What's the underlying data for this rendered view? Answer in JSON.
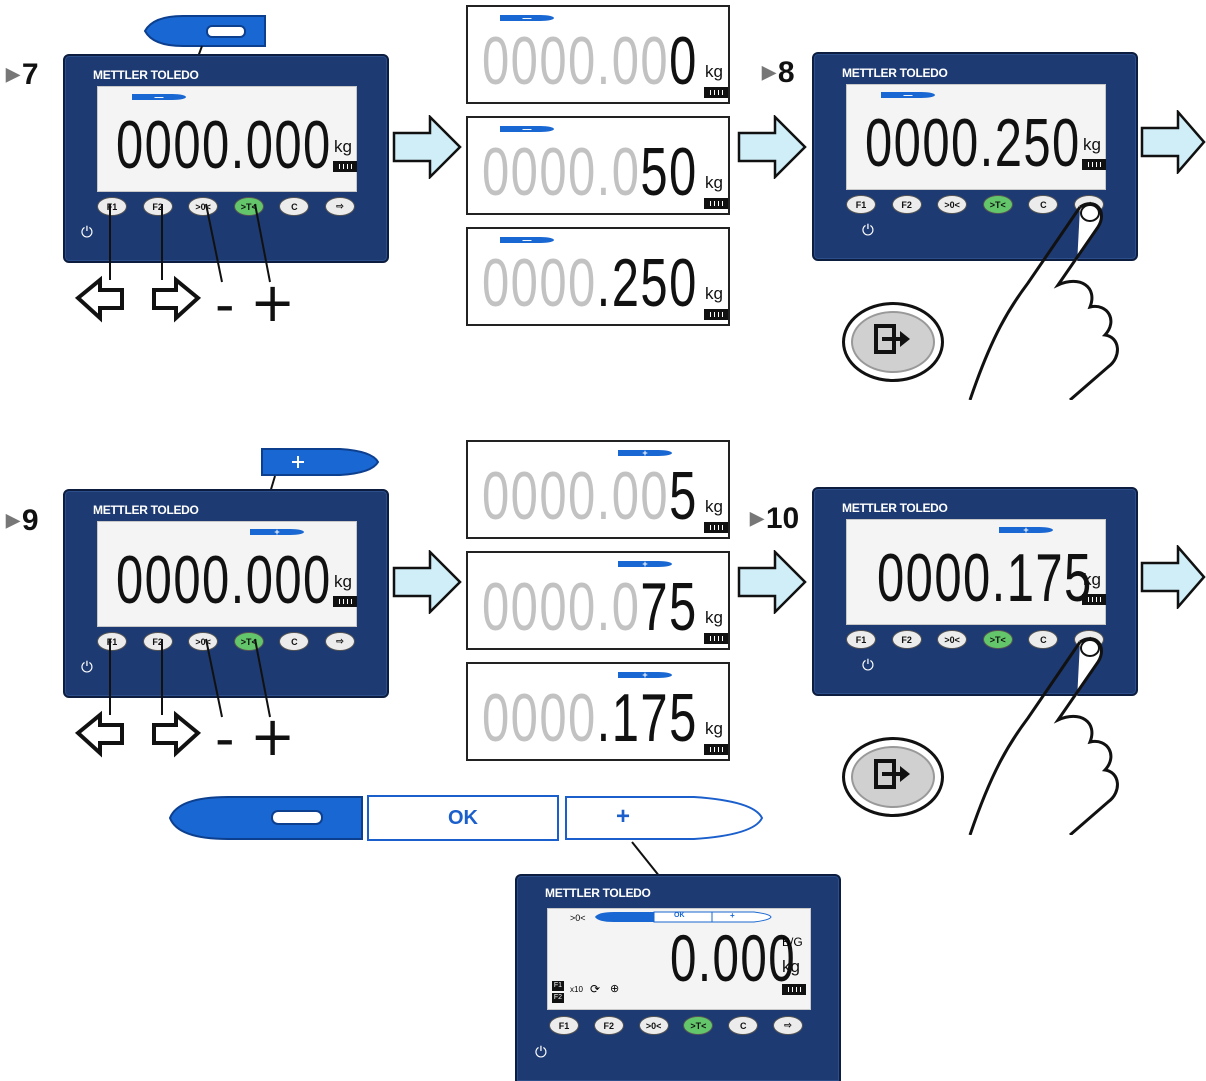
{
  "brand": "METTLER TOLEDO",
  "unit": "kg",
  "steps": {
    "s7": "7",
    "s8": "8",
    "s9": "9",
    "s10": "10"
  },
  "terminal_buttons": [
    "F1",
    "F2",
    ">0<",
    ">T<",
    "C",
    "exit"
  ],
  "step7": {
    "display": "0000.000",
    "bar": "minus"
  },
  "step7_seq": [
    {
      "ghost": "0000.00",
      "active": "0"
    },
    {
      "ghost": "0000.0",
      "active": "50"
    },
    {
      "ghost": "0000",
      "active": ".250"
    }
  ],
  "step8": {
    "display": "0000.250",
    "bar": "minus"
  },
  "step9": {
    "display": "0000.000",
    "bar": "plus"
  },
  "step9_seq": [
    {
      "ghost": "0000.00",
      "active": "5"
    },
    {
      "ghost": "0000.0",
      "active": "75"
    },
    {
      "ghost": "0000",
      "active": ".175"
    }
  ],
  "step10": {
    "display": "0000.175",
    "bar": "plus"
  },
  "key_legend": {
    "left": "⇦",
    "right": "⇨",
    "minus": "-",
    "plus": "+"
  },
  "selector": {
    "minus": "—",
    "ok": "OK",
    "plus": "+"
  },
  "final_terminal": {
    "zero_indicator": ">0<",
    "bar": {
      "minus": "—",
      "ok": "OK",
      "plus": "+"
    },
    "display": "0.000",
    "mode": "B/G",
    "unit": "kg",
    "f1": "F1",
    "f2": "F2",
    "x10": "x10"
  },
  "colors": {
    "terminal": "#1d3a72",
    "accent": "#1967d2",
    "green_key": "#63c66a",
    "arrow": "#cfeef8"
  }
}
